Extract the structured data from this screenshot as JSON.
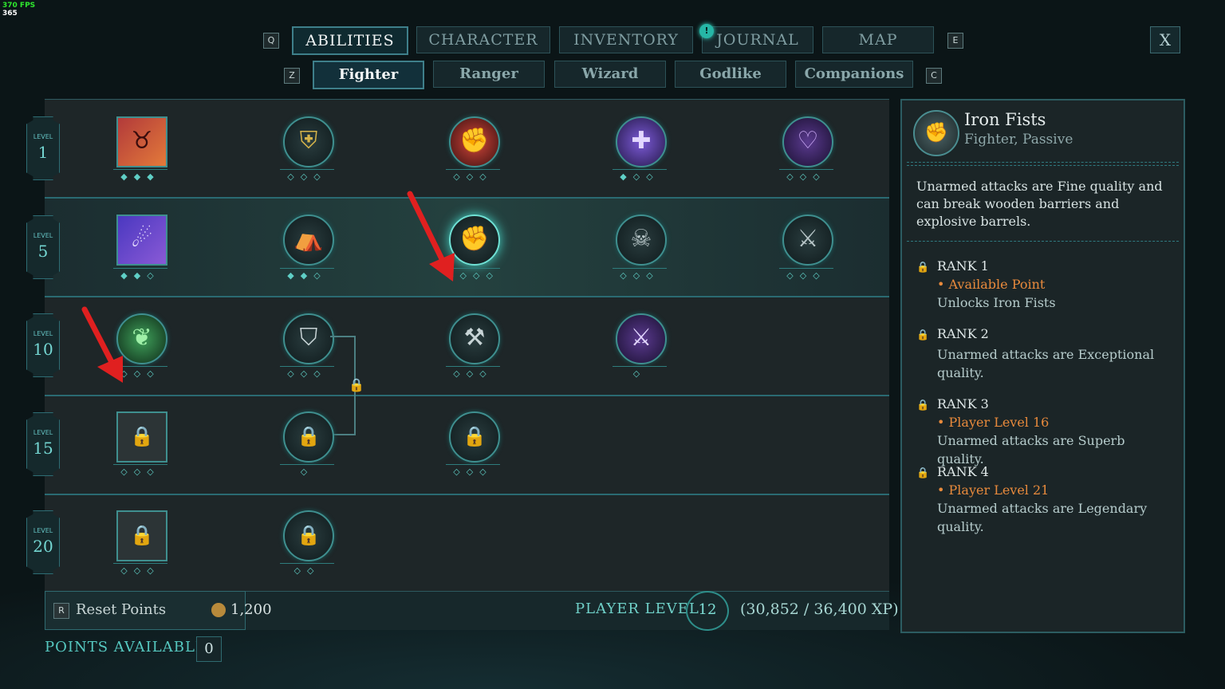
{
  "fps": {
    "fps_label": "370 FPS",
    "value": "365"
  },
  "tabs": {
    "key_left": "Q",
    "key_right": "E",
    "items": [
      "ABILITIES",
      "CHARACTER",
      "INVENTORY",
      "JOURNAL",
      "MAP"
    ],
    "notification": "!"
  },
  "subtabs": {
    "key_left": "Z",
    "key_right": "C",
    "items": [
      "Fighter",
      "Ranger",
      "Wizard",
      "Godlike",
      "Companions"
    ]
  },
  "close_label": "X",
  "levels": [
    {
      "title": "LEVEL",
      "num": "1"
    },
    {
      "title": "LEVEL",
      "num": "5"
    },
    {
      "title": "LEVEL",
      "num": "10"
    },
    {
      "title": "LEVEL",
      "num": "15"
    },
    {
      "title": "LEVEL",
      "num": "20"
    }
  ],
  "icons": {
    "r1": [
      "bull-icon",
      "shield-icon",
      "fist-shield-icon",
      "cross-icon",
      "heart-icon"
    ],
    "r5": [
      "rage-icon",
      "cloak-icon",
      "iron-fists-icon",
      "sword-skull-icon",
      "axe-icon"
    ],
    "r10": [
      "plant-icon",
      "block-icon",
      "hammer-icon",
      "crossed-swords-icon"
    ],
    "r15": [
      "locked-arrow-icon",
      "locked-swirl-icon",
      "locked-hammer-icon"
    ],
    "r20": [
      "locked-spiral-icon",
      "locked-figure-icon"
    ]
  },
  "bottom": {
    "reset_key": "R",
    "reset_label": "Reset Points",
    "reset_cost": "1,200",
    "player_level_label": "PLAYER LEVEL",
    "player_level": "12",
    "xp": "(30,852 / 36,400 XP)",
    "points_label": "POINTS AVAILABLE",
    "points_value": "0"
  },
  "panel": {
    "title": "Iron Fists",
    "subtitle": "Fighter, Passive",
    "description": "Unarmed attacks are Fine quality and can break wooden barriers and explosive barrels.",
    "ranks": [
      {
        "label": "RANK 1",
        "req": "• Available Point",
        "desc": "Unlocks Iron Fists"
      },
      {
        "label": "RANK 2",
        "req": "",
        "desc": "Unarmed attacks are Exceptional quality."
      },
      {
        "label": "RANK 3",
        "req": "• Player Level 16",
        "desc": "Unarmed attacks are Superb quality."
      },
      {
        "label": "RANK 4",
        "req": "• Player Level 21",
        "desc": "Unarmed attacks are Legendary quality."
      }
    ]
  },
  "colors": {
    "accent": "#46d6c8",
    "requirement": "#e88a3c",
    "arrow": "#e02020"
  }
}
